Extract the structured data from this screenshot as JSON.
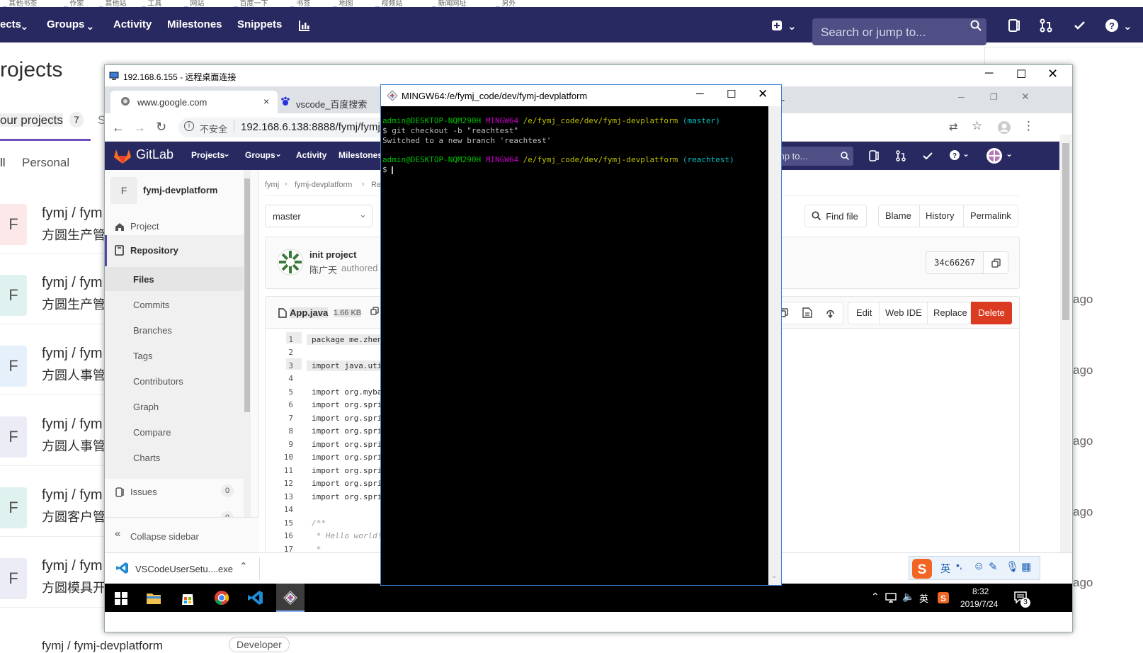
{
  "bookmarks": [
    "_ 其他书签",
    "_ 作家",
    "_ 其他站",
    "_ 工具",
    "_ 网站",
    "_ 百度一下",
    "_ 书签",
    "_ 地图",
    "_ 视频站",
    "_ 新闻网址",
    "_ 另外"
  ],
  "bg": {
    "nav": [
      "ects",
      "Groups",
      "Activity",
      "Milestones",
      "Snippets"
    ],
    "search_placeholder": "Search or jump to...",
    "page_title": "rojects",
    "tab_label": "our projects",
    "tab_count": "7",
    "tab_stub": "S",
    "filter_all": "ll",
    "filter_personal": "Personal",
    "rows": [
      {
        "av": "F",
        "t1": "fymj / fym",
        "t2": "方圆生产管",
        "ago": ""
      },
      {
        "av": "F",
        "t1": "fymj / fym",
        "t2": "方圆生产管",
        "ago": "ago"
      },
      {
        "av": "F",
        "t1": "fymj / fym",
        "t2": "方圆人事管",
        "ago": "ago"
      },
      {
        "av": "F",
        "t1": "fymj / fym",
        "t2": "方圆人事管",
        "ago": "ago"
      },
      {
        "av": "F",
        "t1": "fymj / fym",
        "t2": "方圆客户管",
        "ago": "ago"
      },
      {
        "av": "F",
        "t1": "fymj / fym",
        "t2": "方圆模具开",
        "ago": "ago"
      }
    ],
    "last_row": "fymj / fymj-devplatform",
    "last_badge": "Developer"
  },
  "rdp": {
    "title": "192.168.6.155 - 远程桌面连接"
  },
  "chrome": {
    "tab1": "www.google.com",
    "tab2": "vscode_百度搜索",
    "insecure": "不安全",
    "url": "192.168.6.138:8888/fymj/fymj"
  },
  "gitlab": {
    "brand": "GitLab",
    "nav": [
      "Projects",
      "Groups",
      "Activity",
      "Milestones"
    ],
    "search_stub": "mp to...",
    "project_avatar": "F",
    "project_name": "fymj-devplatform",
    "sidebar": {
      "project": "Project",
      "repository": "Repository",
      "items": [
        "Files",
        "Commits",
        "Branches",
        "Tags",
        "Contributors",
        "Graph",
        "Compare",
        "Charts"
      ],
      "issues": "Issues",
      "issues_count": "0",
      "mr_count": "0",
      "collapse": "Collapse sidebar"
    },
    "breadcrumb": [
      "fymj",
      "fymj-devplatform",
      "Re"
    ],
    "branch": "master",
    "buttons": {
      "find_file": "Find file",
      "blame": "Blame",
      "history": "History",
      "permalink": "Permalink",
      "edit": "Edit",
      "web_ide": "Web IDE",
      "replace": "Replace",
      "delete": "Delete"
    },
    "commit": {
      "message": "init project",
      "author": "陈广天",
      "authored": "authored",
      "sha": "34c66267"
    },
    "file": {
      "name": "App.java",
      "size": "1.66 KB"
    },
    "lines": [
      {
        "n": "1",
        "c": "package me.zhen"
      },
      {
        "n": "2",
        "c": ""
      },
      {
        "n": "3",
        "c": "import java.uti"
      },
      {
        "n": "4",
        "c": ""
      },
      {
        "n": "5",
        "c": "import org.myba"
      },
      {
        "n": "6",
        "c": "import org.spri"
      },
      {
        "n": "7",
        "c": "import org.spri"
      },
      {
        "n": "8",
        "c": "import org.spri"
      },
      {
        "n": "9",
        "c": "import org.spri"
      },
      {
        "n": "10",
        "c": "import org.spri"
      },
      {
        "n": "11",
        "c": "import org.spri"
      },
      {
        "n": "12",
        "c": "import org.spri"
      },
      {
        "n": "13",
        "c": "import org.spri"
      },
      {
        "n": "14",
        "c": ""
      },
      {
        "n": "15",
        "c": "/**"
      },
      {
        "n": "16",
        "c": " * Hello world!"
      },
      {
        "n": "17",
        "c": " *"
      }
    ]
  },
  "download": {
    "file": "VSCodeUserSetu....exe"
  },
  "taskbar": {
    "ime": "英",
    "time": "8:32",
    "date": "2019/7/24",
    "notify": "3",
    "tray_ime": "英"
  },
  "terminal": {
    "title": "MINGW64:/e/fymj_code/dev/fymj-devplatform",
    "user": "admin@DESKTOP-NQM290H",
    "env": "MINGW64",
    "path": "/e/fymj_code/dev/fymj-devplatform",
    "branch1": "(master)",
    "cmd": "$ git checkout -b \"reachtest\"",
    "out": "Switched to a new branch 'reachtest'",
    "branch2": "(reachtest)",
    "prompt": "$"
  },
  "colors": {
    "nav": "#292961",
    "delete": "#db3b21",
    "term_bg": "#000000",
    "term_green": "#00c000",
    "term_magenta": "#c000c0",
    "term_yellow": "#c0c000",
    "term_cyan": "#00c0c0"
  }
}
